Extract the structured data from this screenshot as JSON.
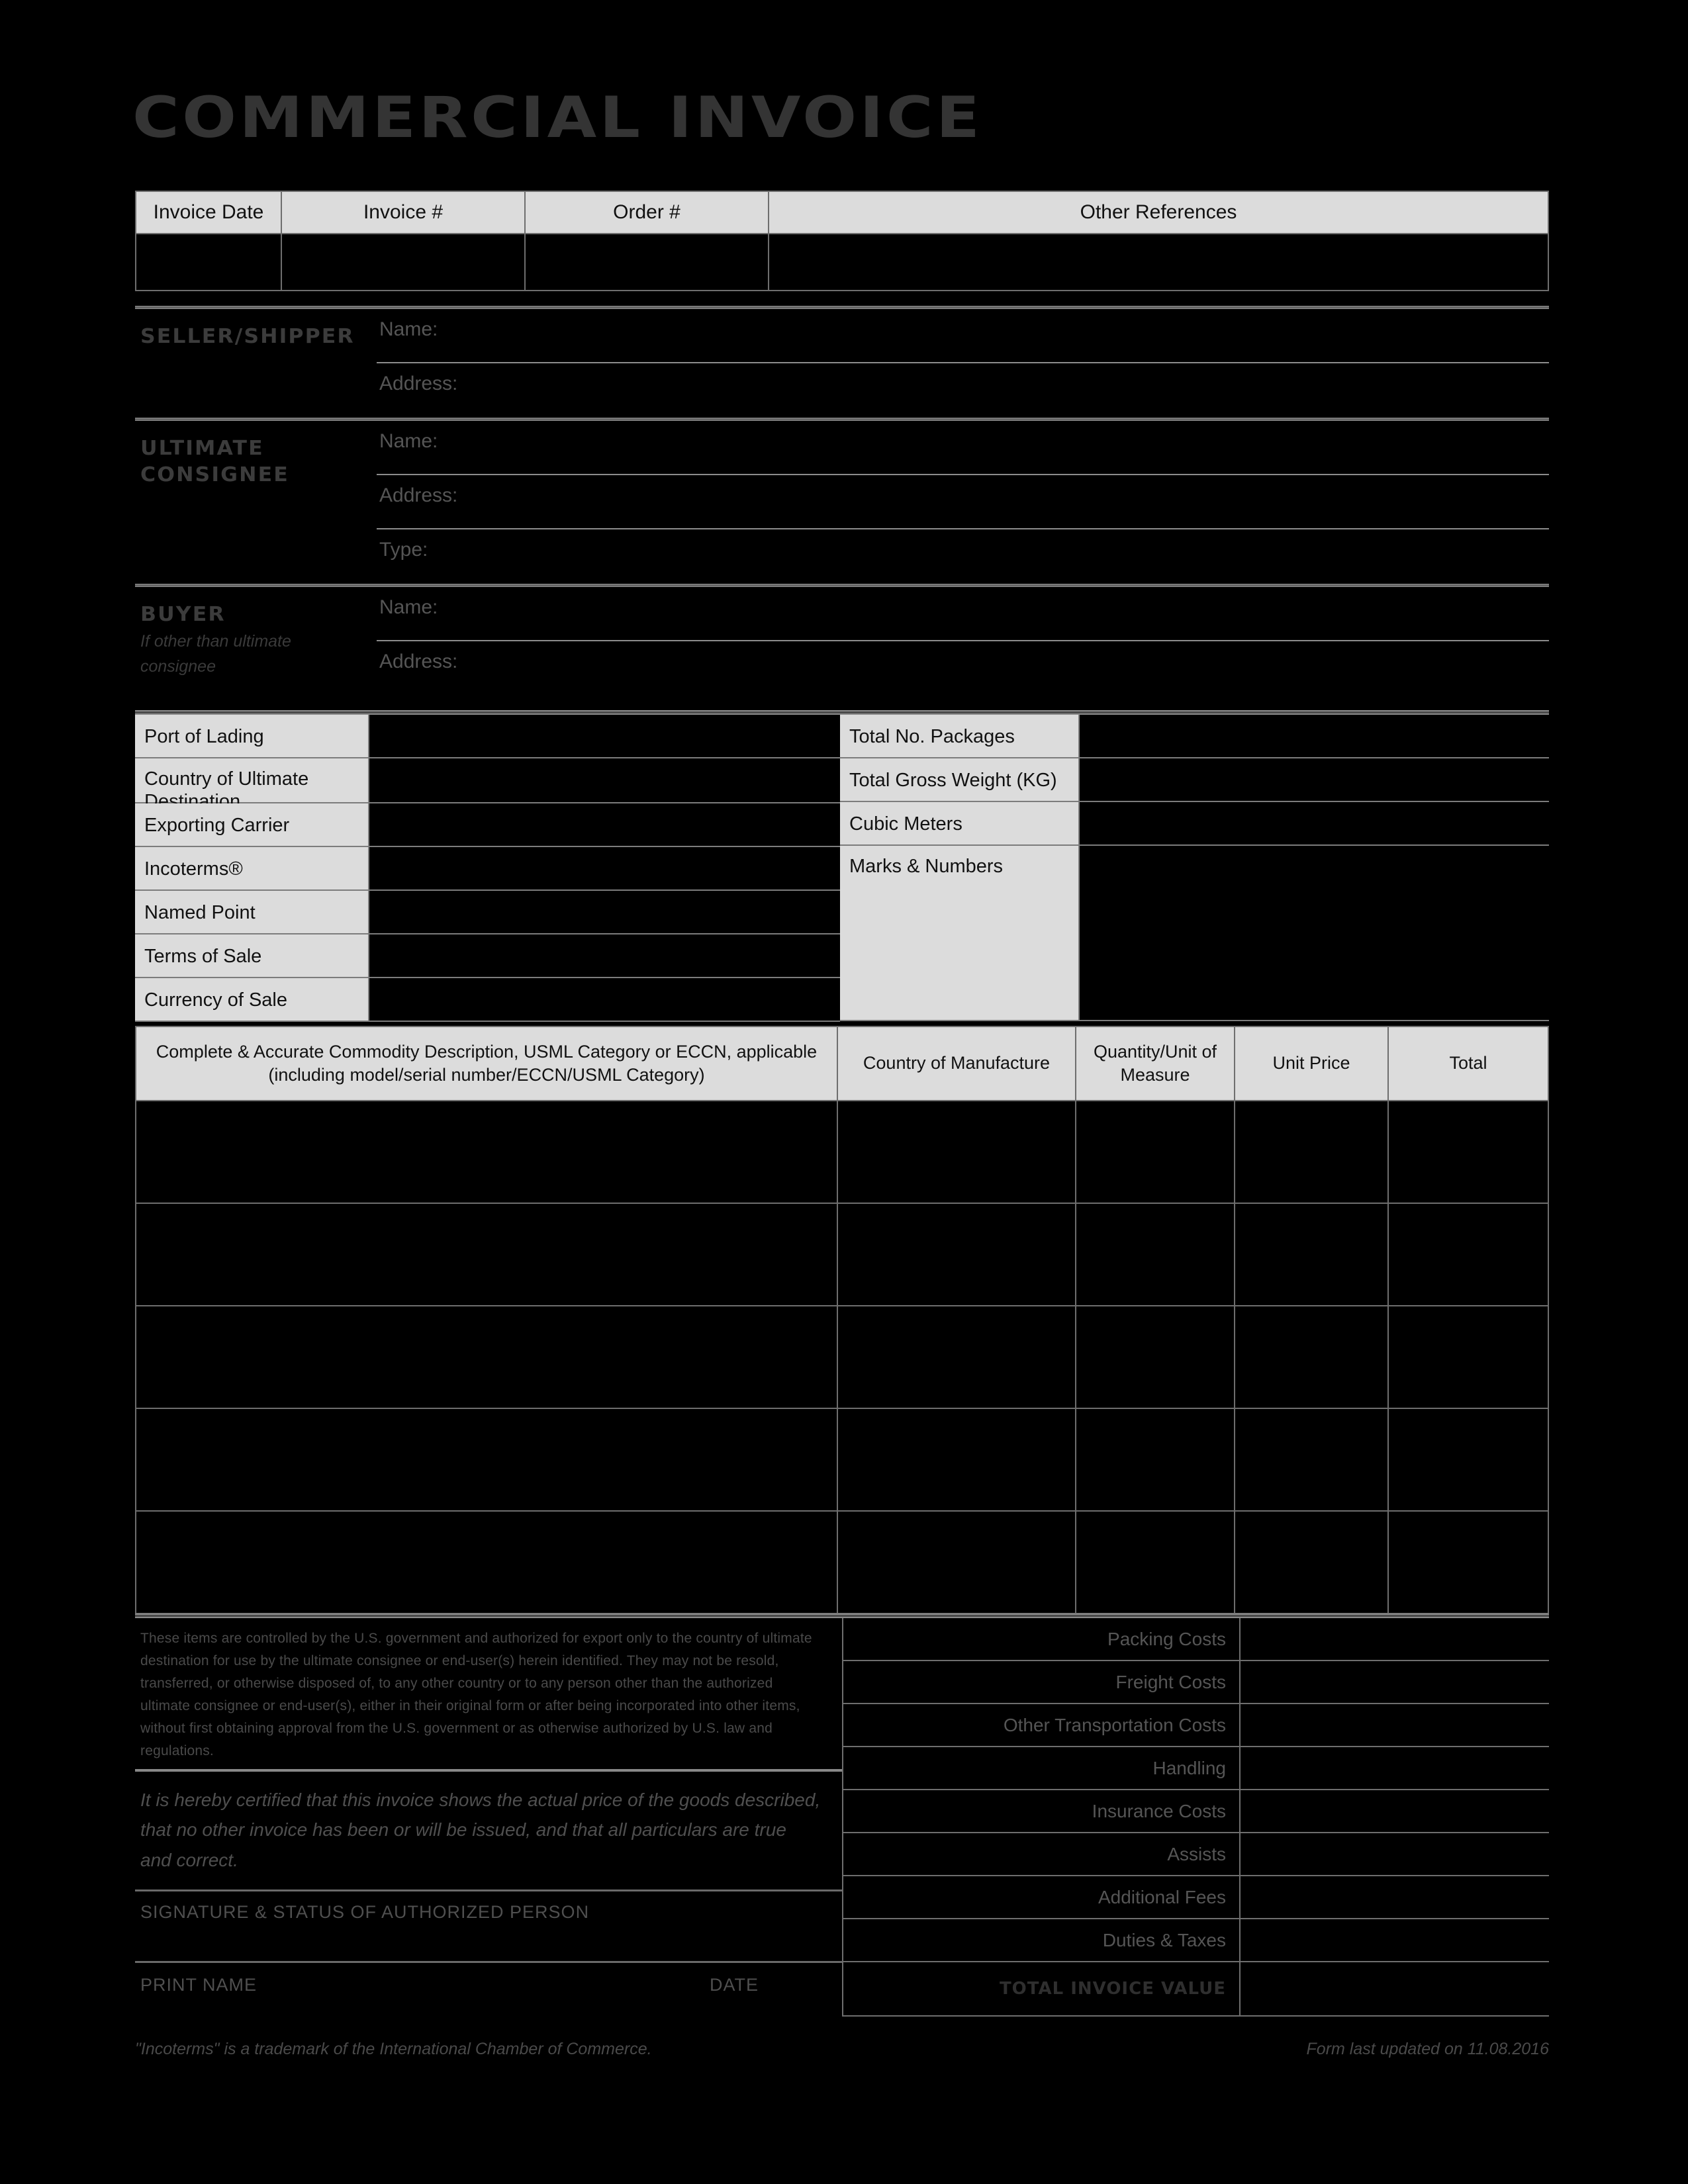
{
  "document": {
    "title": "COMMERCIAL INVOICE"
  },
  "reference_table": {
    "headers": [
      "Invoice Date",
      "Invoice #",
      "Order #",
      "Other References"
    ],
    "values": [
      "",
      "",
      "",
      ""
    ]
  },
  "parties": {
    "seller": {
      "label": "SELLER/SHIPPER",
      "fields": [
        {
          "label": "Name:",
          "value": ""
        },
        {
          "label": "Address:",
          "value": ""
        }
      ]
    },
    "consignee": {
      "label_line1": "ULTIMATE",
      "label_line2": "CONSIGNEE",
      "fields": [
        {
          "label": "Name:",
          "value": ""
        },
        {
          "label": "Address:",
          "value": ""
        },
        {
          "label": "Type:",
          "value": ""
        }
      ]
    },
    "buyer": {
      "label": "BUYER",
      "sub_line1": "If other than ultimate",
      "sub_line2": "consignee",
      "fields": [
        {
          "label": "Name:",
          "value": ""
        },
        {
          "label": "Address:",
          "value": ""
        }
      ]
    }
  },
  "shipping": {
    "left_rows": [
      {
        "label": "Port of Lading",
        "value": ""
      },
      {
        "label": "Country of Ultimate Destination",
        "value": ""
      },
      {
        "label": "Exporting Carrier",
        "value": ""
      },
      {
        "label": "Incoterms®",
        "value": ""
      },
      {
        "label": "Named Point",
        "value": ""
      },
      {
        "label": "Terms of Sale",
        "value": ""
      },
      {
        "label": "Currency of Sale",
        "value": ""
      }
    ],
    "right_rows": [
      {
        "label": "Total No. Packages",
        "value": ""
      },
      {
        "label": "Total Gross Weight (KG)",
        "value": ""
      },
      {
        "label": "Cubic Meters",
        "value": ""
      },
      {
        "label": "Marks & Numbers",
        "value": ""
      }
    ]
  },
  "commodity_table": {
    "headers": [
      "Complete & Accurate Commodity Description, USML Category or ECCN, applicable (including model/serial number/ECCN/USML Category)",
      "Country of Manufacture",
      "Quantity/Unit of Measure",
      "Unit Price",
      "Total"
    ],
    "rows": [
      [
        "",
        "",
        "",
        "",
        ""
      ],
      [
        "",
        "",
        "",
        "",
        ""
      ],
      [
        "",
        "",
        "",
        "",
        ""
      ],
      [
        "",
        "",
        "",
        "",
        ""
      ],
      [
        "",
        "",
        "",
        "",
        ""
      ]
    ]
  },
  "legal": {
    "destination_control": "These items are controlled by the U.S. government and authorized for export only to the country of ultimate destination for use by the ultimate consignee or end-user(s) herein identified.  They may not be resold, transferred, or otherwise disposed of, to any other country or to any person other than the authorized ultimate consignee or end-user(s), either in their original form or after being incorporated into other items, without first obtaining approval from the U.S. government or as otherwise authorized by U.S. law and regulations.",
    "certification": "It is hereby certified that this invoice shows the actual price of the goods described, that no other invoice has been or will be issued, and that all particulars are true and correct.",
    "signature_label": "SIGNATURE & STATUS OF AUTHORIZED PERSON",
    "print_name_label": "PRINT NAME",
    "date_label": "DATE"
  },
  "costs": {
    "rows": [
      {
        "label": "Packing Costs",
        "value": ""
      },
      {
        "label": "Freight Costs",
        "value": ""
      },
      {
        "label": "Other Transportation Costs",
        "value": ""
      },
      {
        "label": "Handling",
        "value": ""
      },
      {
        "label": "Insurance Costs",
        "value": ""
      },
      {
        "label": "Assists",
        "value": ""
      },
      {
        "label": "Additional Fees",
        "value": ""
      },
      {
        "label": "Duties & Taxes",
        "value": ""
      }
    ],
    "total": {
      "label": "TOTAL INVOICE VALUE",
      "value": ""
    }
  },
  "footer": {
    "trademark_note": "\"Incoterms\" is a trademark of the International Chamber of Commerce.",
    "updated_note": "Form last updated on 11.08.2016"
  },
  "colors": {
    "background": "#000000",
    "label_fill": "#dcdcdc",
    "border": "#6e6e6e",
    "title_text": "#343434",
    "muted_text": "#4f4f4f"
  }
}
